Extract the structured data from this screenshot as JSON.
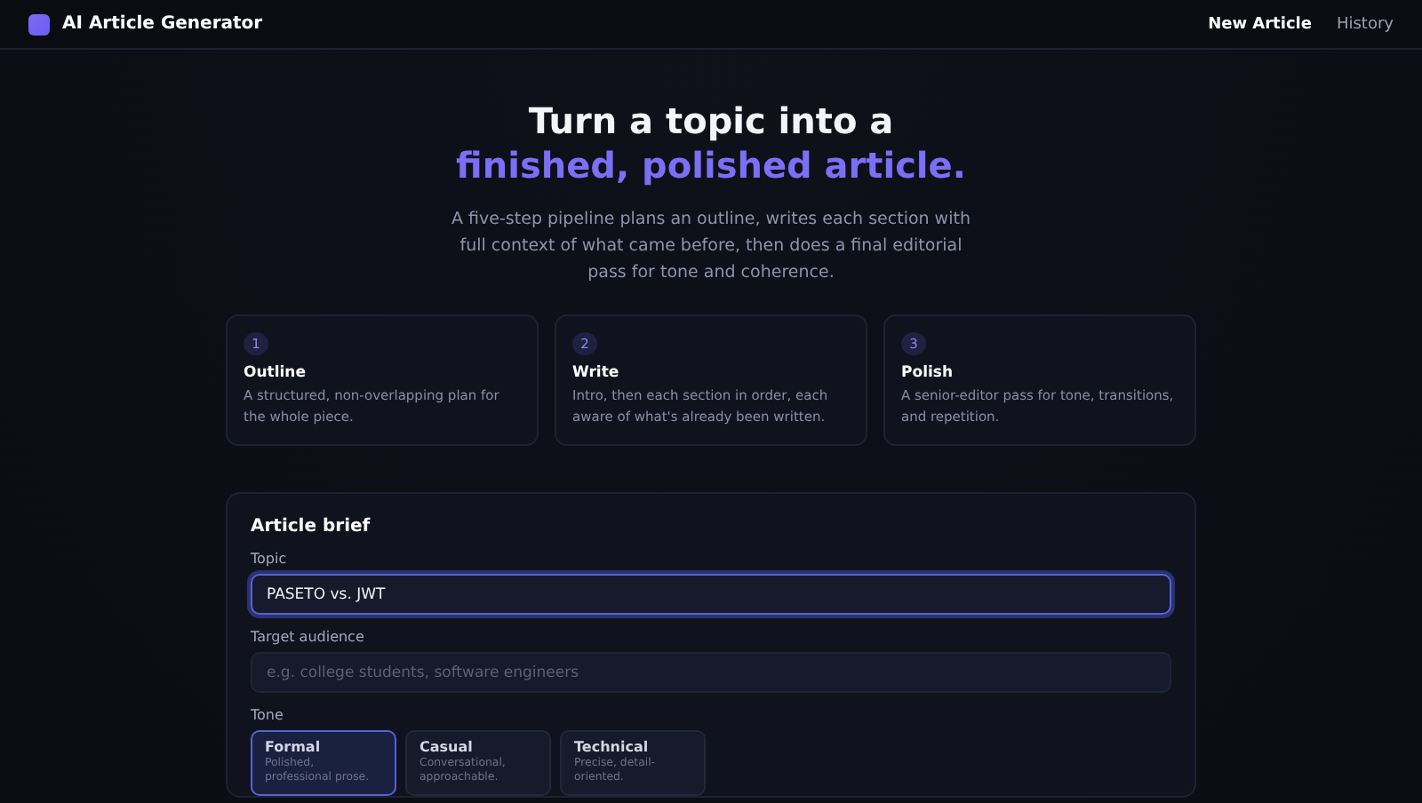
{
  "header": {
    "app_name": "AI Article Generator",
    "nav": [
      {
        "label": "New Article",
        "selected": true
      },
      {
        "label": "History",
        "selected": false
      }
    ]
  },
  "hero": {
    "title_line_1": "Turn a topic into a",
    "title_line_2": "finished, polished article.",
    "subtitle": "A five-step pipeline plans an outline, writes each section with full context of what came before, then does a final editorial pass for tone and coherence."
  },
  "steps": [
    {
      "number": "1",
      "title": "Outline",
      "description": "A structured, non-overlapping plan for the whole piece."
    },
    {
      "number": "2",
      "title": "Write",
      "description": "Intro, then each section in order, each aware of what's already been written."
    },
    {
      "number": "3",
      "title": "Polish",
      "description": "A senior-editor pass for tone, transitions, and repetition."
    }
  ],
  "brief": {
    "title": "Article brief",
    "topic": {
      "label": "Topic",
      "value": "PASETO vs. JWT"
    },
    "audience": {
      "label": "Target audience",
      "placeholder": "e.g. college students, software engineers"
    },
    "tone": {
      "label": "Tone",
      "options": [
        {
          "title": "Formal",
          "description": "Polished, professional prose.",
          "selected": true
        },
        {
          "title": "Casual",
          "description": "Conversational, approachable.",
          "selected": false
        },
        {
          "title": "Technical",
          "description": "Precise, detail-oriented.",
          "selected": false
        }
      ]
    }
  }
}
